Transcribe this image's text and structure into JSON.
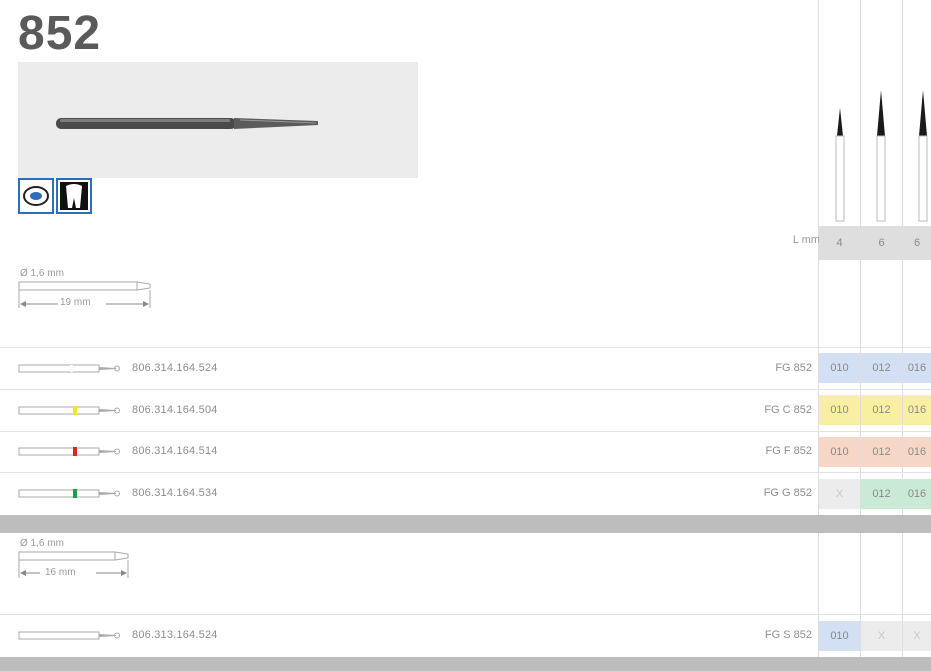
{
  "product": {
    "number": "852"
  },
  "colors": {
    "blue": "#d3dff3",
    "yellow": "#f9efa3",
    "red": "#f6d6c6",
    "green": "#c9ead6",
    "grey": "#ececec",
    "accent_icon": "#2c6fb8"
  },
  "icons": [
    "mouth-icon",
    "tooth-icon"
  ],
  "lengths": {
    "label": "L mm",
    "values": [
      "4",
      "6",
      "6"
    ]
  },
  "dimension_top": {
    "diameter": "Ø 1,6 mm",
    "length": "19 mm"
  },
  "dimension_bottom": {
    "diameter": "Ø 1,6 mm",
    "length": "16 mm"
  },
  "rows": [
    {
      "number": "806.314.164.524",
      "code": "FG 852",
      "bar_color": "#ffffff",
      "sizes": [
        "010",
        "012",
        "016"
      ],
      "size_color": "#d3dff3"
    },
    {
      "number": "806.314.164.504",
      "code": "FG C 852",
      "bar_color": "#f2e41f",
      "sizes": [
        "010",
        "012",
        "016"
      ],
      "size_color": "#f9efa3"
    },
    {
      "number": "806.314.164.514",
      "code": "FG F 852",
      "bar_color": "#d62a1e",
      "sizes": [
        "010",
        "012",
        "016"
      ],
      "size_color": "#f6d6c6"
    },
    {
      "number": "806.314.164.534",
      "code": "FG G 852",
      "bar_color": "#1f9d4e",
      "sizes": [
        "X",
        "012",
        "016"
      ],
      "size_color": "#c9ead6"
    }
  ],
  "bottom_row": {
    "number": "806.313.164.524",
    "code": "FG S 852",
    "sizes": [
      "010",
      "X",
      "X"
    ]
  }
}
